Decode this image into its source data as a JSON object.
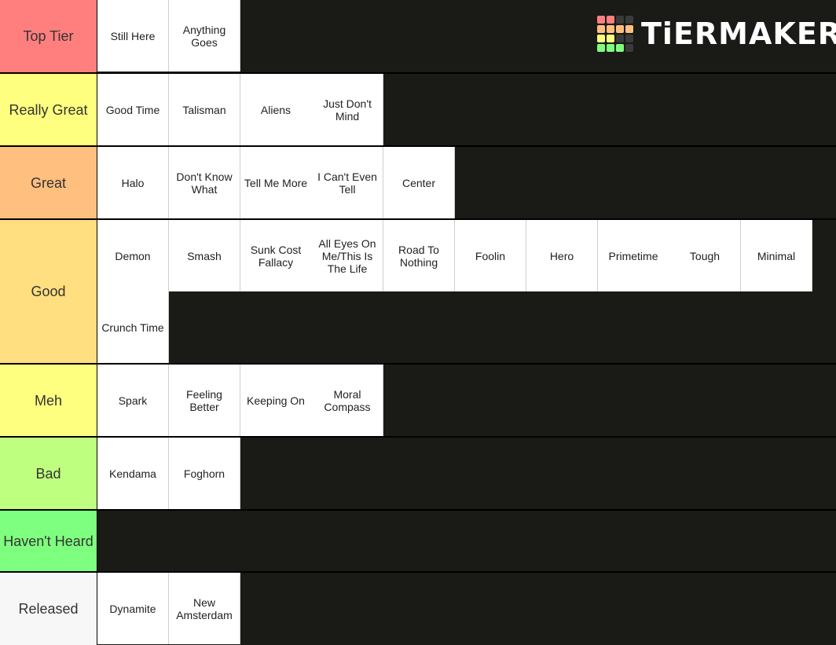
{
  "logo": {
    "text": "TiERMAKER",
    "grid_colors": [
      "#ff7f7f",
      "#ff7f7f",
      "#3a3a3a",
      "#3a3a3a",
      "#ffbf7f",
      "#ffbf7f",
      "#ffbf7f",
      "#ffbf7f",
      "#ffff7f",
      "#ffff7f",
      "#3a3a3a",
      "#3a3a3a",
      "#7fff7f",
      "#7fff7f",
      "#7fff7f",
      "#3a3a3a"
    ]
  },
  "tiers": [
    {
      "label": "Top Tier",
      "color": "#ff7f7f",
      "items": [
        "Still Here",
        "Anything Goes"
      ]
    },
    {
      "label": "Really Great",
      "color": "#ffff7f",
      "items": [
        "Good Time",
        "Talisman",
        "Aliens",
        "Just Don't Mind"
      ]
    },
    {
      "label": "Great",
      "color": "#ffbf7f",
      "items": [
        "Halo",
        "Don't Know What",
        "Tell Me More",
        "I Can't Even Tell",
        "Center"
      ]
    },
    {
      "label": "Good",
      "color": "#ffdf7f",
      "items": [
        "Demon",
        "Smash",
        "Sunk Cost Fallacy",
        "All Eyes On Me/This Is The Life",
        "Road To Nothing",
        "Foolin",
        "Hero",
        "Primetime",
        "Tough",
        "Minimal",
        "Crunch Time"
      ]
    },
    {
      "label": "Meh",
      "color": "#ffff7f",
      "items": [
        "Spark",
        "Feeling Better",
        "Keeping On",
        "Moral Compass"
      ]
    },
    {
      "label": "Bad",
      "color": "#bfff7f",
      "items": [
        "Kendama",
        "Foghorn"
      ]
    },
    {
      "label": "Haven't Heard",
      "color": "#7fff7f",
      "items": []
    },
    {
      "label": "Released",
      "color": "#f7f7f7",
      "items": [
        "Dynamite",
        "New Amsterdam"
      ]
    }
  ]
}
